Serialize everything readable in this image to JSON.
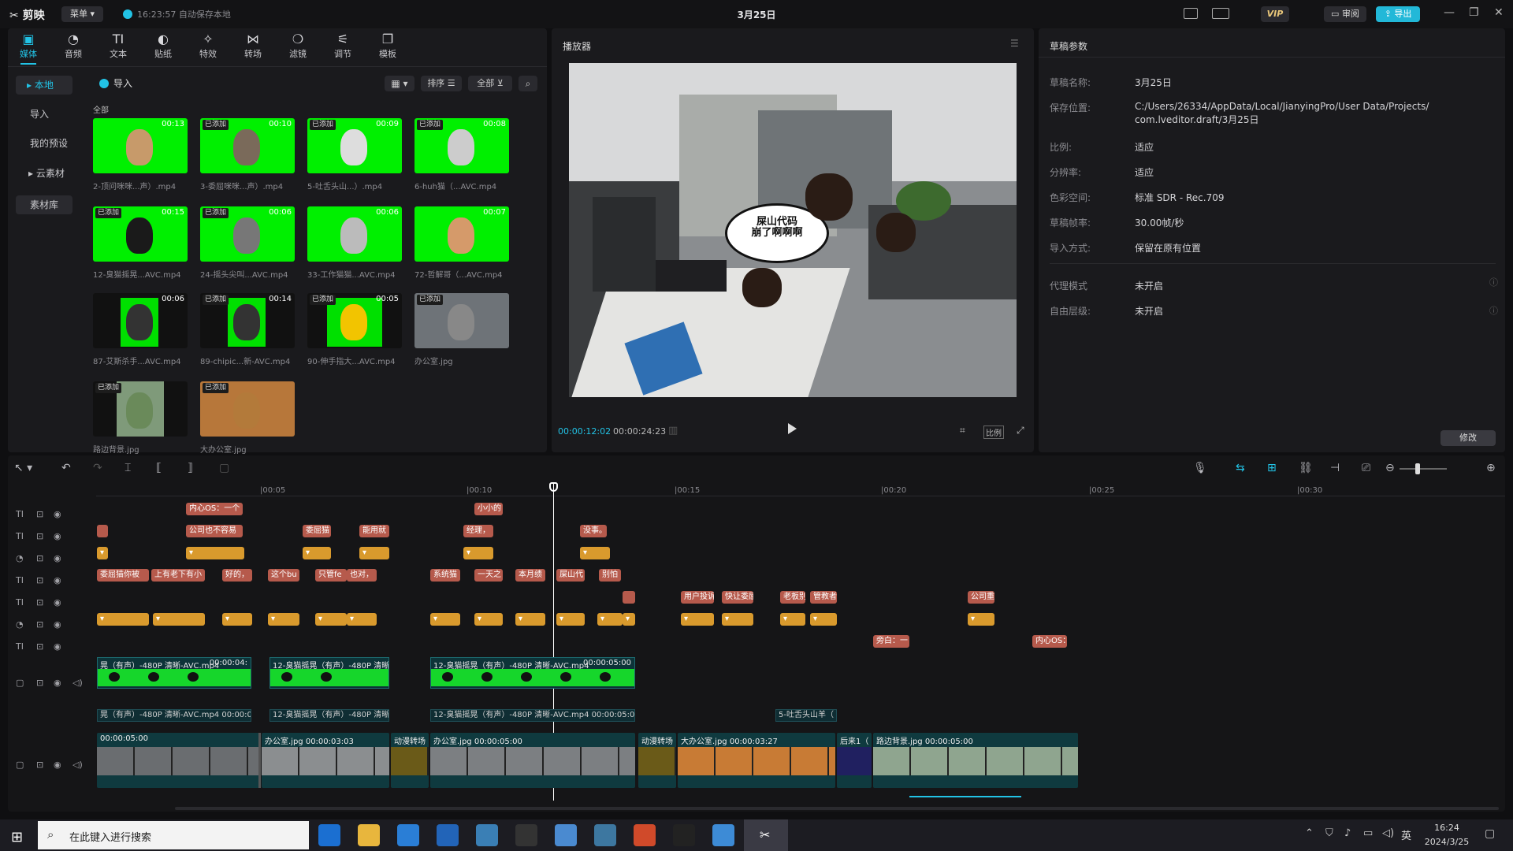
{
  "app": {
    "logo": "剪映",
    "menu_label": "菜单",
    "save_status": "16:23:57 自动保存本地",
    "title": "3月25日"
  },
  "titlebar": {
    "vip": "VIP",
    "review": "审阅",
    "export": "导出"
  },
  "toolbar": {
    "items": [
      {
        "label": "媒体",
        "icon": "media-icon",
        "glyph": "▣"
      },
      {
        "label": "音频",
        "icon": "audio-icon",
        "glyph": "◔"
      },
      {
        "label": "文本",
        "icon": "text-icon",
        "glyph": "TI"
      },
      {
        "label": "贴纸",
        "icon": "sticker-icon",
        "glyph": "◐"
      },
      {
        "label": "特效",
        "icon": "effects-icon",
        "glyph": "✧"
      },
      {
        "label": "转场",
        "icon": "transition-icon",
        "glyph": "⋈"
      },
      {
        "label": "滤镜",
        "icon": "filter-icon",
        "glyph": "❍"
      },
      {
        "label": "调节",
        "icon": "adjust-icon",
        "glyph": "⚟"
      },
      {
        "label": "模板",
        "icon": "template-icon",
        "glyph": "❐"
      }
    ]
  },
  "sidebar": {
    "items": [
      "本地",
      "导入",
      "我的预设",
      "云素材",
      "素材库"
    ]
  },
  "media": {
    "import_label": "导入",
    "sort_label": "排序",
    "filter_label": "全部",
    "section_label": "全部",
    "items": [
      {
        "name": "2-顶问咪咪...声）.mp4",
        "duration": "00:13",
        "added": ""
      },
      {
        "name": "3-委屈咪咪...声）.mp4",
        "duration": "00:10",
        "added": "已添加"
      },
      {
        "name": "5-吐舌头山...）.mp4",
        "duration": "00:09",
        "added": "已添加"
      },
      {
        "name": "6-huh猫（...AVC.mp4",
        "duration": "00:08",
        "added": "已添加"
      },
      {
        "name": "12-臭猫摇晃...AVC.mp4",
        "duration": "00:15",
        "added": "已添加"
      },
      {
        "name": "24-摇头尖叫...AVC.mp4",
        "duration": "00:06",
        "added": "已添加"
      },
      {
        "name": "33-工作猫猫...AVC.mp4",
        "duration": "00:06",
        "added": ""
      },
      {
        "name": "72-哲解哥（...AVC.mp4",
        "duration": "00:07",
        "added": ""
      },
      {
        "name": "87-艾斯杀手...AVC.mp4",
        "duration": "00:06",
        "added": ""
      },
      {
        "name": "89-chipic...新-AVC.mp4",
        "duration": "00:14",
        "added": "已添加"
      },
      {
        "name": "90-伸手指大...AVC.mp4",
        "duration": "00:05",
        "added": "已添加"
      },
      {
        "name": "办公室.jpg",
        "duration": "",
        "added": "已添加"
      },
      {
        "name": "路边背景.jpg",
        "duration": "",
        "added": "已添加"
      },
      {
        "name": "大办公室.jpg",
        "duration": "",
        "added": "已添加"
      }
    ]
  },
  "player": {
    "title": "播放器",
    "current_time": "00:00:12:02",
    "total_time": "00:00:24:23",
    "ratio_label": "比例",
    "bubble_text": "屎山代码\n崩了啊啊啊"
  },
  "draft": {
    "title": "草稿参数",
    "params": [
      {
        "label": "草稿名称:",
        "value": "3月25日"
      },
      {
        "label": "保存位置:",
        "value": "C:/Users/26334/AppData/Local/JianyingPro/User Data/Projects/",
        "value2": "com.lveditor.draft/3月25日"
      },
      {
        "label": "比例:",
        "value": "适应"
      },
      {
        "label": "分辨率:",
        "value": "适应"
      },
      {
        "label": "色彩空间:",
        "value": "标准 SDR - Rec.709"
      },
      {
        "label": "草稿帧率:",
        "value": "30.00帧/秒"
      },
      {
        "label": "导入方式:",
        "value": "保留在原有位置"
      },
      {
        "label": "代理模式",
        "value": "未开启"
      },
      {
        "label": "自由层级:",
        "value": "未开启"
      }
    ],
    "edit_button": "修改"
  },
  "timeline": {
    "ruler": [
      "|00:05",
      "|00:10",
      "|00:15",
      "|00:20",
      "|00:25",
      "|00:30"
    ],
    "text_clips_row1": [
      "内心OS：一个",
      "小小的"
    ],
    "text_clips_row2": [
      "",
      "公司也不容易",
      "委屈猫",
      "能用就",
      "经理，",
      "没事。"
    ],
    "text_clips_row4": [
      "委屈猫你被",
      "上有老下有小",
      "好的，",
      "这个bu",
      "只管fe",
      "也对，",
      "系统猫",
      "一天之",
      "本月绩",
      "屎山代",
      "别怕"
    ],
    "text_clips_row5": [
      "",
      "用户投诉",
      "快让委屈",
      "老板别",
      "管教者",
      "公司重"
    ],
    "text_clips_row7": [
      "旁白：一",
      "内心OS："
    ],
    "video_clips": [
      {
        "label": "晃（有声）-480P 清晰-AVC.mp4",
        "dur": "00:00:04:"
      },
      {
        "label": "12-臭猫摇晃（有声）-480P 清晰",
        "dur": ""
      },
      {
        "label": "12-臭猫摇晃（有声）-480P 清晰-AVC.mp4",
        "dur": "00:00:05:00"
      }
    ],
    "audio_clips": [
      {
        "label": "晃（有声）-480P 清晰-AVC.mp4  00:00:04:"
      },
      {
        "label": "12-臭猫摇晃（有声）-480P 清晰"
      },
      {
        "label": "12-臭猫摇晃（有声）-480P 清晰-AVC.mp4  00:00:05:00"
      },
      {
        "label": "5-吐舌头山羊（"
      }
    ],
    "main_clips": [
      {
        "label": "00:00:05:00"
      },
      {
        "label": "办公室.jpg  00:00:03:03"
      },
      {
        "label": "动漫转场"
      },
      {
        "label": "办公室.jpg  00:00:05:00"
      },
      {
        "label": "动漫转场"
      },
      {
        "label": "大办公室.jpg  00:00:03:27"
      },
      {
        "label": "后来1（"
      },
      {
        "label": "路边背景.jpg  00:00:05:00"
      }
    ]
  },
  "taskbar": {
    "search_placeholder": "在此键入进行搜索",
    "time": "16:24",
    "date": "2024/3/25",
    "ime": "英"
  }
}
